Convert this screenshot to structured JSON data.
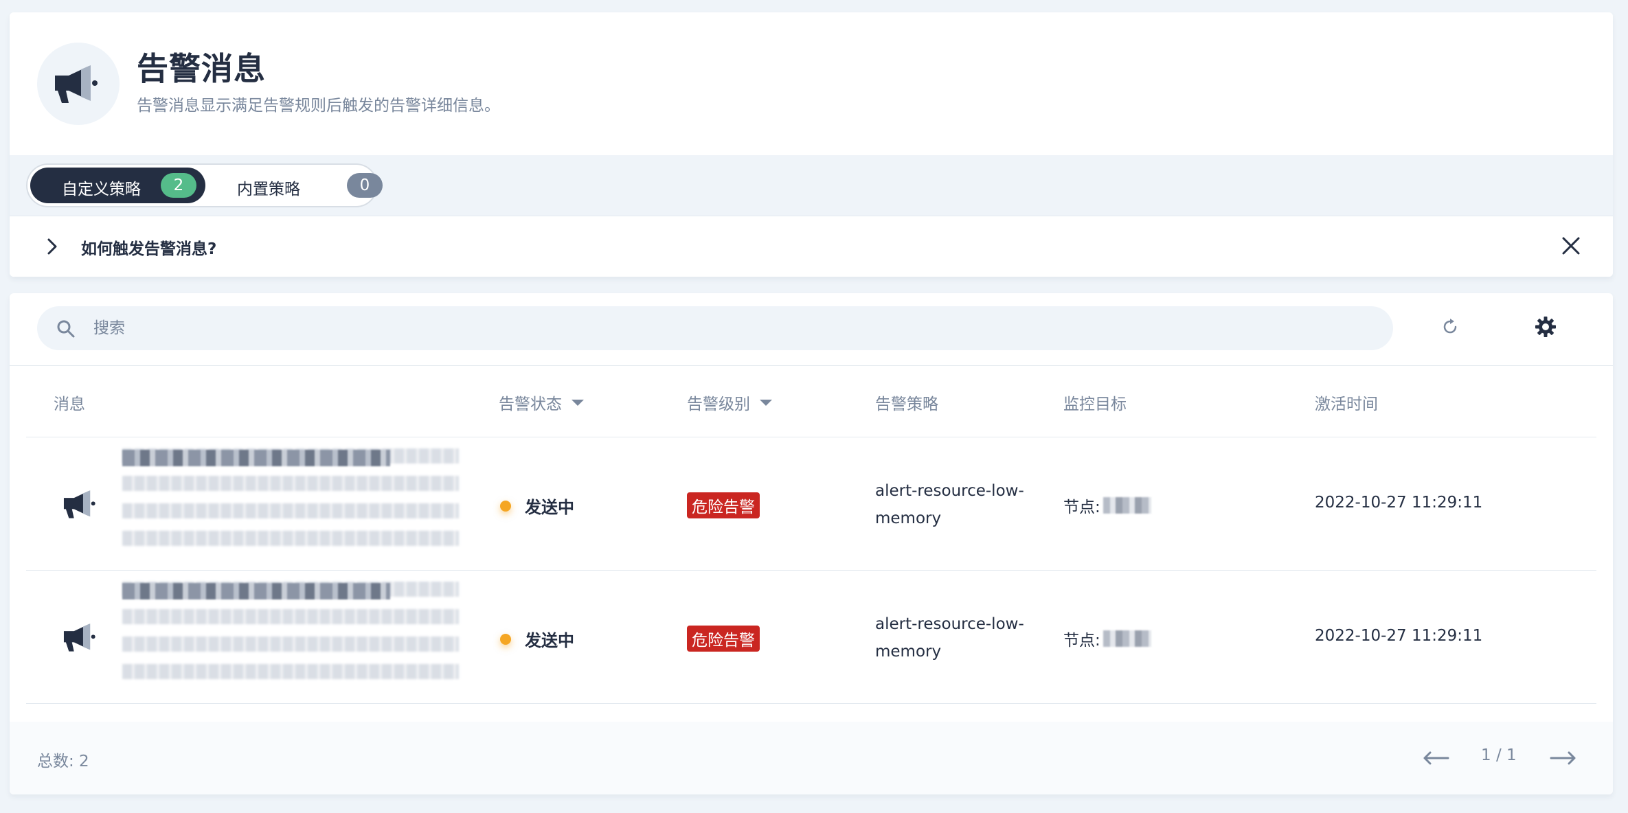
{
  "header": {
    "title": "告警消息",
    "description": "告警消息显示满足告警规则后触发的告警详细信息。",
    "icon": "megaphone-icon"
  },
  "tabs": [
    {
      "label": "自定义策略",
      "count": "2",
      "active": true
    },
    {
      "label": "内置策略",
      "count": "0",
      "active": false
    }
  ],
  "tip": {
    "text": "如何触发告警消息?"
  },
  "search": {
    "placeholder": "搜索"
  },
  "table": {
    "columns": {
      "message": "消息",
      "status": "告警状态",
      "level": "告警级别",
      "policy": "告警策略",
      "target": "监控目标",
      "time": "激活时间"
    },
    "rows": [
      {
        "status": "发送中",
        "level": "危险告警",
        "policy": "alert-resource-low-memory",
        "target_prefix": "节点:",
        "time": "2022-10-27 11:29:11"
      },
      {
        "status": "发送中",
        "level": "危险告警",
        "policy": "alert-resource-low-memory",
        "target_prefix": "节点:",
        "time": "2022-10-27 11:29:11"
      }
    ]
  },
  "footer": {
    "total": "总数: 2",
    "page": "1 / 1"
  },
  "colors": {
    "primary_dark": "#242e42",
    "secondary_text": "#79879c",
    "success_green": "#55bc8a",
    "danger_red": "#ca2621",
    "warning_orange": "#f5a623",
    "background": "#eff4f9"
  }
}
